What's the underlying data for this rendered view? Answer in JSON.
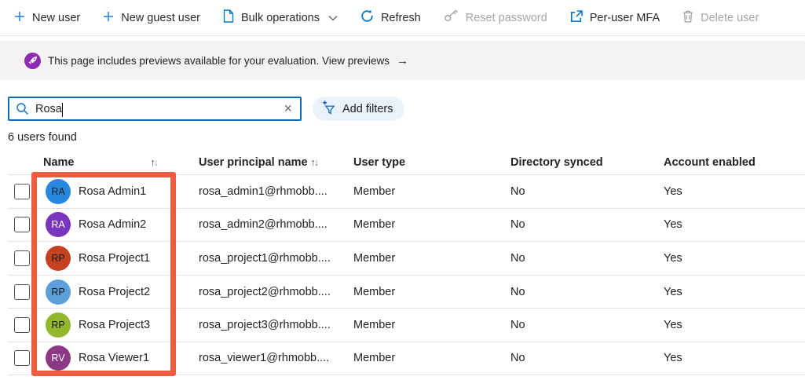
{
  "toolbar": {
    "items": [
      {
        "label": "New user",
        "icon": "plus-icon",
        "disabled": false
      },
      {
        "label": "New guest user",
        "icon": "plus-icon",
        "disabled": false
      },
      {
        "label": "Bulk operations",
        "icon": "document-icon",
        "disabled": false,
        "has_dropdown": true
      },
      {
        "label": "Refresh",
        "icon": "refresh-icon",
        "disabled": false
      },
      {
        "label": "Reset password",
        "icon": "key-icon",
        "disabled": true
      },
      {
        "label": "Per-user MFA",
        "icon": "external-link-icon",
        "disabled": false
      },
      {
        "label": "Delete user",
        "icon": "trash-icon",
        "disabled": true
      }
    ]
  },
  "banner": {
    "icon": "rocket-icon",
    "icon_color": "#8f2bb0",
    "text": "This page includes previews available for your evaluation.",
    "link_label": "View previews",
    "arrow": "→"
  },
  "search": {
    "value": "Rosa",
    "icon": "search-icon",
    "clear_glyph": "×"
  },
  "filters": {
    "add_label": "Add filters",
    "icon": "filter-plus-icon"
  },
  "results_count": "6 users found",
  "glyphs": {
    "sort_up": "↑",
    "sort_down": "↓",
    "chevron_down": "⌄"
  },
  "table": {
    "columns": [
      {
        "label": "Name",
        "sortable": true
      },
      {
        "label": "User principal name",
        "sortable": true
      },
      {
        "label": "User type",
        "sortable": false
      },
      {
        "label": "Directory synced",
        "sortable": false
      },
      {
        "label": "Account enabled",
        "sortable": false
      }
    ],
    "rows": [
      {
        "initials": "RA",
        "avatar_color": "#2788df",
        "initials_color": "#1b1a19",
        "name": "Rosa Admin1",
        "upn": "rosa_admin1@rhmobb....",
        "user_type": "Member",
        "directory_synced": "No",
        "account_enabled": "Yes"
      },
      {
        "initials": "RA",
        "avatar_color": "#7a35bf",
        "initials_color": "#ffffff",
        "name": "Rosa Admin2",
        "upn": "rosa_admin2@rhmobb....",
        "user_type": "Member",
        "directory_synced": "No",
        "account_enabled": "Yes"
      },
      {
        "initials": "RP",
        "avatar_color": "#c5411f",
        "initials_color": "#1b1a19",
        "name": "Rosa Project1",
        "upn": "rosa_project1@rhmobb....",
        "user_type": "Member",
        "directory_synced": "No",
        "account_enabled": "Yes"
      },
      {
        "initials": "RP",
        "avatar_color": "#5c9fd9",
        "initials_color": "#1b1a19",
        "name": "Rosa Project2",
        "upn": "rosa_project2@rhmobb....",
        "user_type": "Member",
        "directory_synced": "No",
        "account_enabled": "Yes"
      },
      {
        "initials": "RP",
        "avatar_color": "#93b72e",
        "initials_color": "#1b1a19",
        "name": "Rosa Project3",
        "upn": "rosa_project3@rhmobb....",
        "user_type": "Member",
        "directory_synced": "No",
        "account_enabled": "Yes"
      },
      {
        "initials": "RV",
        "avatar_color": "#8b3984",
        "initials_color": "#ffffff",
        "name": "Rosa Viewer1",
        "upn": "rosa_viewer1@rhmobb....",
        "user_type": "Member",
        "directory_synced": "No",
        "account_enabled": "Yes"
      }
    ]
  },
  "highlight": {
    "color": "#ee5b41",
    "purpose": "name-column-highlight"
  }
}
